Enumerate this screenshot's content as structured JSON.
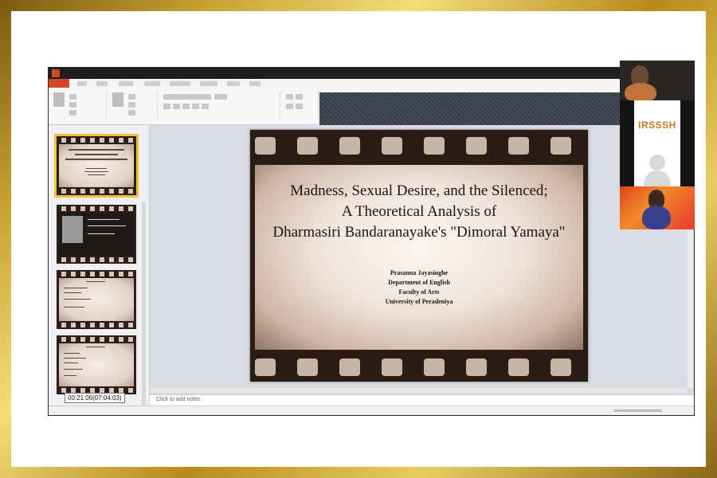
{
  "recording": {
    "timestamp": "00:21:06(07:04:03)"
  },
  "slide": {
    "title_lines": [
      "Madness, Sexual Desire, and the Silenced;",
      "A Theoretical Analysis of",
      "Dharmasiri Bandaranayake's \"Dimoral Yamaya\""
    ],
    "subtitle_lines": [
      "Prasanna Jayasinghe",
      "Department of English",
      "Faculty of Arts",
      "University of Peradeniya"
    ]
  },
  "notes": {
    "placeholder": "Click to add notes"
  },
  "participants": {
    "logo_text": "IRSSSH"
  },
  "colors": {
    "accent": "#d24726",
    "frame_gold": "#c9a232",
    "selected_outline": "#f1c232"
  },
  "icons": [
    "powerpoint-logo-icon",
    "user-avatar-icon"
  ]
}
